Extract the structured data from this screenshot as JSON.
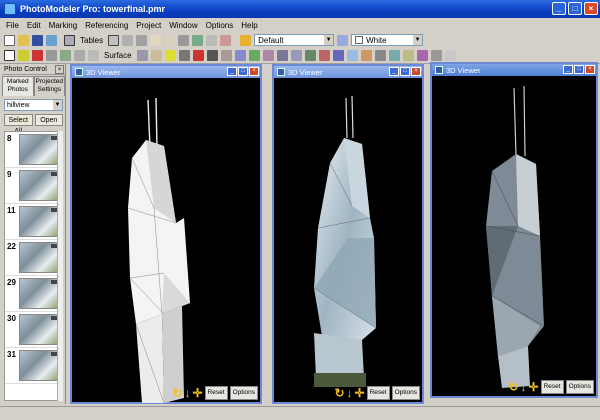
{
  "window": {
    "title": "PhotoModeler Pro: towerfinal.pmr"
  },
  "menu": [
    "File",
    "Edit",
    "Marking",
    "Referencing",
    "Project",
    "Window",
    "Options",
    "Help"
  ],
  "toolbar": {
    "tables_label": "Tables",
    "surface_label": "Surface",
    "style_combo": "Default",
    "color_combo": "White"
  },
  "panel": {
    "title": "Photo Control",
    "tab1": "Marked Photos",
    "tab2": "Projected",
    "tab3": "Settings",
    "filter": "hillview",
    "select_all": "Select All",
    "open": "Open",
    "thumbs": [
      "8",
      "9",
      "11",
      "22",
      "29",
      "30",
      "31"
    ]
  },
  "viewers": [
    {
      "title": "3D Viewer",
      "reset": "Reset",
      "options": "Options"
    },
    {
      "title": "3D Viewer",
      "reset": "Reset",
      "options": "Options"
    },
    {
      "title": "3D Viewer",
      "reset": "Reset",
      "options": "Options"
    }
  ],
  "colors": {
    "accent": "#0a3fc2",
    "viewer_border": "#6b8ad6",
    "control_icon": "#f0c020"
  }
}
